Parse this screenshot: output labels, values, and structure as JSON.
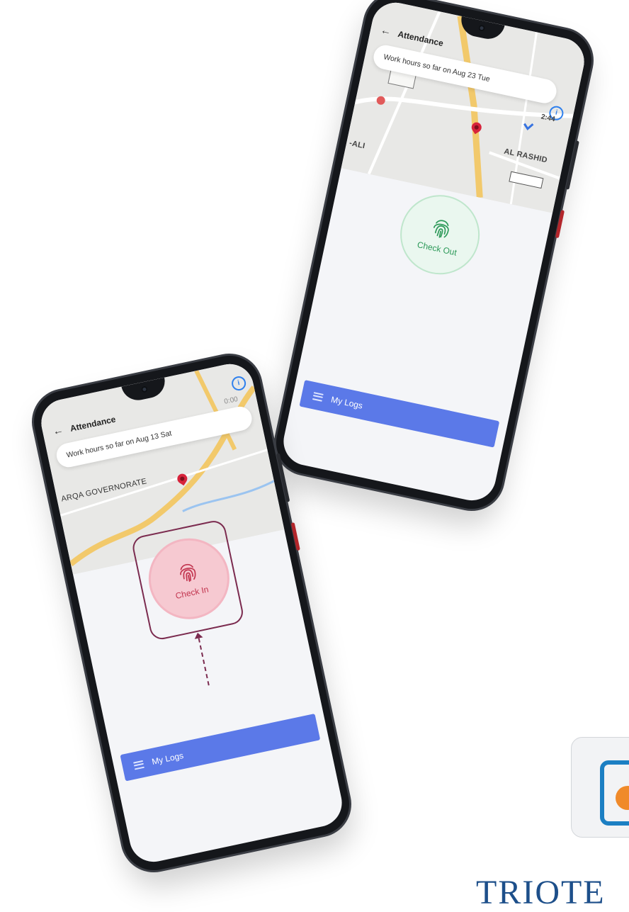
{
  "phone_front": {
    "header_title": "Attendance",
    "hours_label": "Work hours so far on Aug 13 Sat",
    "hours_value": "0:00",
    "map_label": "ARQA GOVERNORATE",
    "checkin_label": "Check In",
    "logs_label": "My Logs"
  },
  "phone_back": {
    "header_title": "Attendance",
    "hours_label": "Work hours so far on Aug 23 Tue",
    "hours_value": "2:44",
    "map_label_1": "AL RASHID",
    "map_label_2": "-ALI",
    "checkout_label": "Check Out",
    "logs_label": "My Logs"
  },
  "brand": {
    "name": "TRIOTE"
  },
  "colors": {
    "accent_blue": "#5b79e8",
    "checkin_pink": "#f6c9d1",
    "checkout_green": "#2e9a5a",
    "highlight": "#7b2b4f"
  }
}
